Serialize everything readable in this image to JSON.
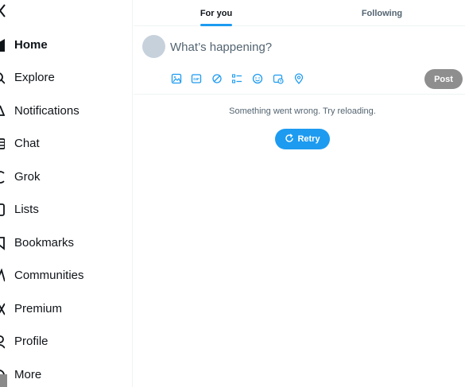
{
  "sidebar": {
    "logo": "x-logo-icon",
    "items": [
      {
        "label": "Home",
        "icon": "home-icon",
        "active": true
      },
      {
        "label": "Explore",
        "icon": "search-icon"
      },
      {
        "label": "Notifications",
        "icon": "bell-icon"
      },
      {
        "label": "Chat",
        "icon": "chat-icon"
      },
      {
        "label": "Grok",
        "icon": "grok-icon"
      },
      {
        "label": "Lists",
        "icon": "list-icon"
      },
      {
        "label": "Bookmarks",
        "icon": "bookmark-icon"
      },
      {
        "label": "Communities",
        "icon": "communities-icon"
      },
      {
        "label": "Premium",
        "icon": "x-premium-icon"
      },
      {
        "label": "Profile",
        "icon": "profile-icon"
      },
      {
        "label": "More",
        "icon": "more-icon"
      }
    ]
  },
  "tabs": [
    {
      "label": "For you",
      "active": true
    },
    {
      "label": "Following",
      "active": false
    }
  ],
  "composer": {
    "placeholder": "What’s happening?",
    "tools": [
      "image-icon",
      "gif-icon",
      "grok-image-icon",
      "poll-icon",
      "emoji-icon",
      "schedule-icon",
      "location-icon"
    ],
    "post_label": "Post"
  },
  "feed": {
    "error_message": "Something went wrong. Try reloading.",
    "retry_label": "Retry"
  },
  "colors": {
    "accent": "#1d9bf0",
    "text": "#0f1419",
    "secondary_text": "#536471",
    "post_disabled": "#8e8e8e"
  }
}
